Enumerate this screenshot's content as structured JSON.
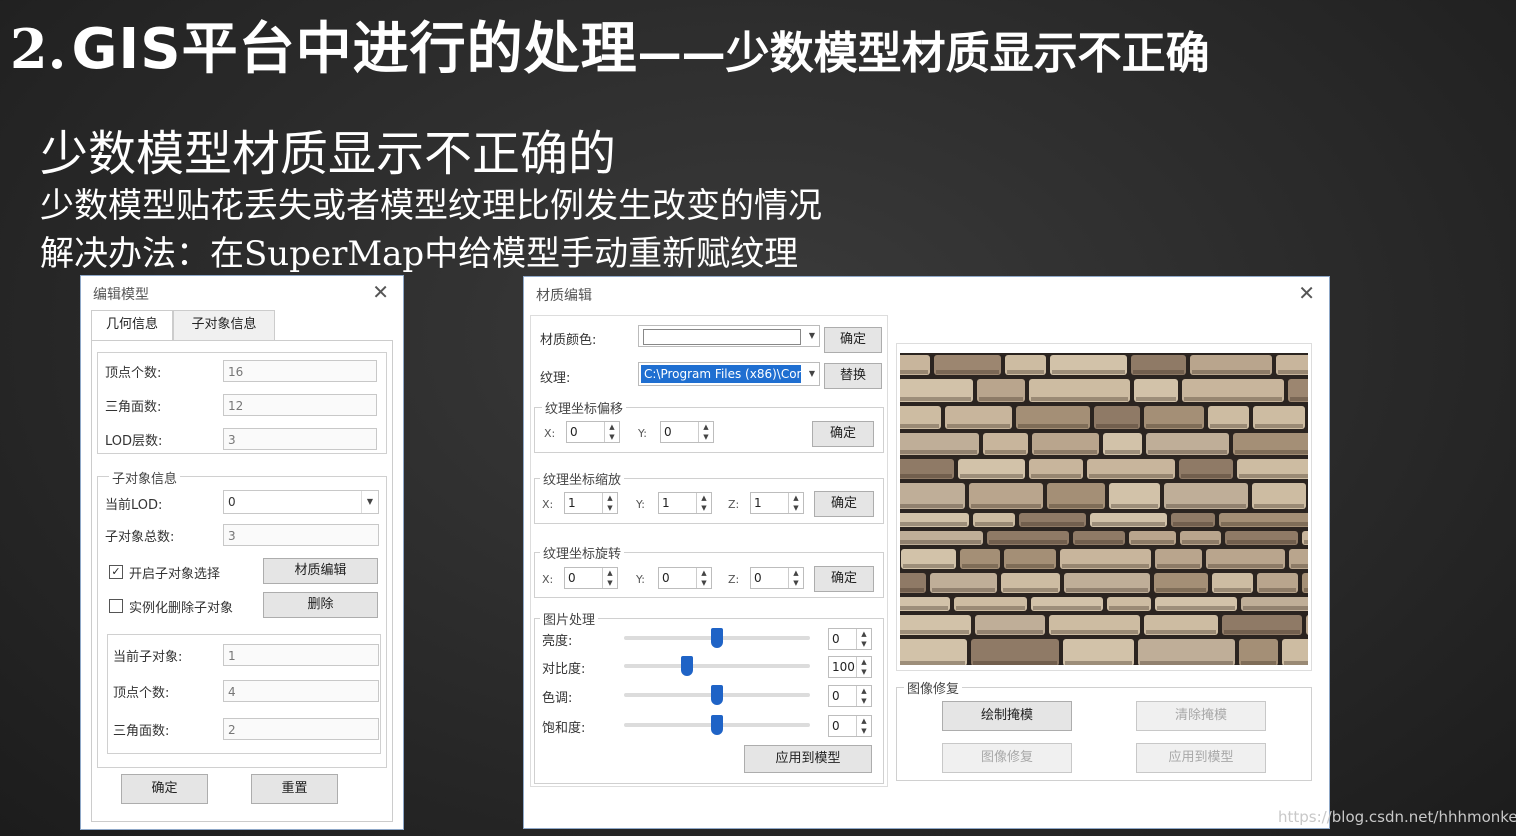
{
  "slide": {
    "title_num": "2.",
    "title_main": "GIS平台中进行的处理",
    "title_dash": "——",
    "title_sub": "少数模型材质显示不正确",
    "heading": "少数模型材质显示不正确的",
    "line1": "少数模型贴花丢失或者模型纹理比例发生改变的情况",
    "line2_prefix": "解决办法：在",
    "line2_en": "SuperMap",
    "line2_suffix": "中给模型手动重新赋纹理",
    "watermark": "https://blog.csdn.net/hhhmonkey"
  },
  "edit_model": {
    "title": "编辑模型",
    "close_glyph": "✕",
    "tabs": [
      "几何信息",
      "子对象信息"
    ],
    "vertex_label": "顶点个数:",
    "vertex_value": "16",
    "tri_label": "三角面数:",
    "tri_value": "12",
    "lod_label": "LOD层数:",
    "lod_value": "3",
    "sub_group": "子对象信息",
    "cur_lod_label": "当前LOD:",
    "cur_lod_value": "0",
    "sub_total_label": "子对象总数:",
    "sub_total_value": "3",
    "enable_select_label": "开启子对象选择",
    "enable_select_checked": "✓",
    "material_btn": "材质编辑",
    "instance_delete_label": "实例化删除子对象",
    "delete_btn": "删除",
    "cur_sub_label": "当前子对象:",
    "cur_sub_value": "1",
    "sub_vertex_label": "顶点个数:",
    "sub_vertex_value": "4",
    "sub_tri_label": "三角面数:",
    "sub_tri_value": "2",
    "ok_btn": "确定",
    "reset_btn": "重置"
  },
  "material_edit": {
    "title": "材质编辑",
    "close_glyph": "✕",
    "color_label": "材质颜色:",
    "color_ok": "确定",
    "texture_label": "纹理:",
    "texture_path": "C:\\Program Files (x86)\\Com",
    "replace_btn": "替换",
    "offset_group": "纹理坐标偏移",
    "offset_x": "0",
    "offset_y": "0",
    "scale_group": "纹理坐标缩放",
    "scale_x": "1",
    "scale_y": "1",
    "scale_z": "1",
    "rotate_group": "纹理坐标旋转",
    "rotate_x": "0",
    "rotate_y": "0",
    "rotate_z": "0",
    "x_label": "X:",
    "y_label": "Y:",
    "z_label": "Z:",
    "ok": "确定",
    "image_group": "图片处理",
    "brightness_label": "亮度:",
    "brightness_value": "0",
    "brightness_pos": 0.5,
    "contrast_label": "对比度:",
    "contrast_value": "100",
    "contrast_pos": 0.34,
    "hue_label": "色调:",
    "hue_value": "0",
    "hue_pos": 0.5,
    "saturation_label": "饱和度:",
    "saturation_value": "0",
    "saturation_pos": 0.5,
    "apply_btn": "应用到模型",
    "repair_group": "图像修复",
    "draw_mask_btn": "绘制掩模",
    "clear_mask_btn": "清除掩模",
    "repair_btn": "图像修复",
    "apply_repair_btn": "应用到模型"
  }
}
